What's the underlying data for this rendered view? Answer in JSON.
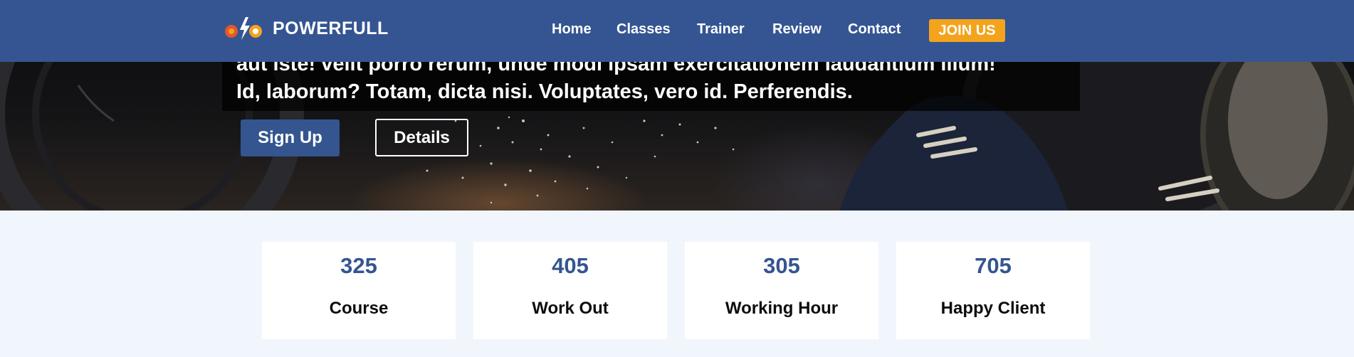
{
  "colors": {
    "navbar_bg": "#355592",
    "accent_orange": "#f4a31d",
    "primary_blue": "#34558f",
    "page_bg": "#f1f6fd"
  },
  "navbar": {
    "brand": "POWERFULL",
    "brand_icon": "dumbbell-lightning-icon",
    "links": [
      "Home",
      "Classes",
      "Trainer",
      "Review",
      "Contact"
    ],
    "cta_label": "JOIN US"
  },
  "hero": {
    "text_line1": "aut iste! velit porro rerum, unde modi ipsam exercitationem laudantium illum!",
    "text_line2": "Id, laborum? Totam, dicta nisi. Voluptates, vero id. Perferendis.",
    "signup_label": "Sign Up",
    "details_label": "Details"
  },
  "stats": [
    {
      "value": "325",
      "label": "Course"
    },
    {
      "value": "405",
      "label": "Work Out"
    },
    {
      "value": "305",
      "label": "Working Hour"
    },
    {
      "value": "705",
      "label": "Happy Client"
    }
  ]
}
